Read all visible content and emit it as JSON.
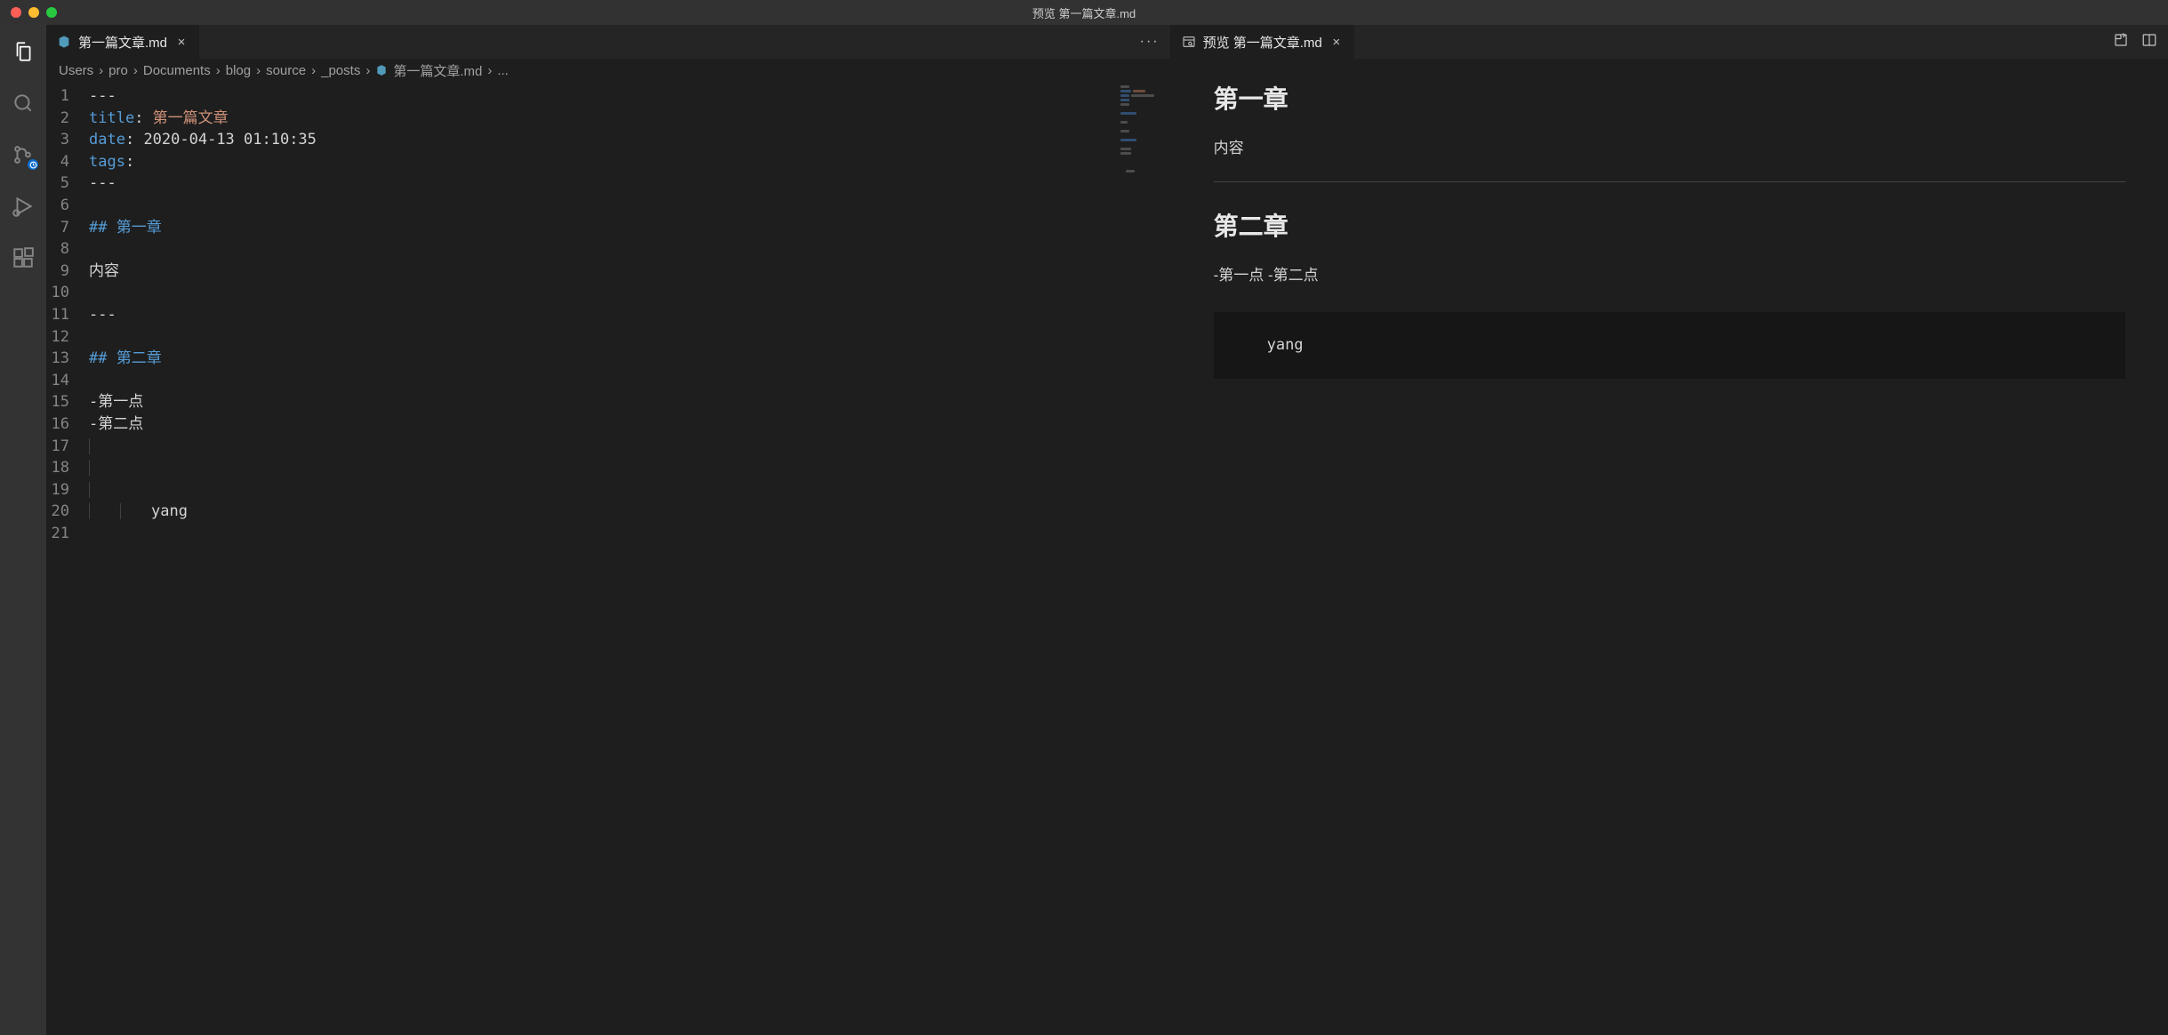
{
  "window_title": "预览 第一篇文章.md",
  "tabs": {
    "left": {
      "filename": "第一篇文章.md"
    },
    "right": {
      "filename": "预览 第一篇文章.md"
    }
  },
  "breadcrumbs": [
    "Users",
    "pro",
    "Documents",
    "blog",
    "source",
    "_posts",
    "第一篇文章.md",
    "..."
  ],
  "editor": {
    "line_count": 21,
    "frontmatter": {
      "title_key": "title",
      "title_val": "第一篇文章",
      "date_key": "date",
      "date_val": "2020-04-13 01:10:35",
      "tags_key": "tags"
    },
    "dashes": "---",
    "h1_marker": "## ",
    "h1_text": "第一章",
    "body1": "内容",
    "h2_marker": "## ",
    "h2_text": "第二章",
    "bullet1": "-第一点",
    "bullet2": "-第二点",
    "codeword": "yang"
  },
  "preview": {
    "h1": "第一章",
    "p1": "内容",
    "h2": "第二章",
    "p2": "-第一点 -第二点",
    "code": "yang"
  }
}
